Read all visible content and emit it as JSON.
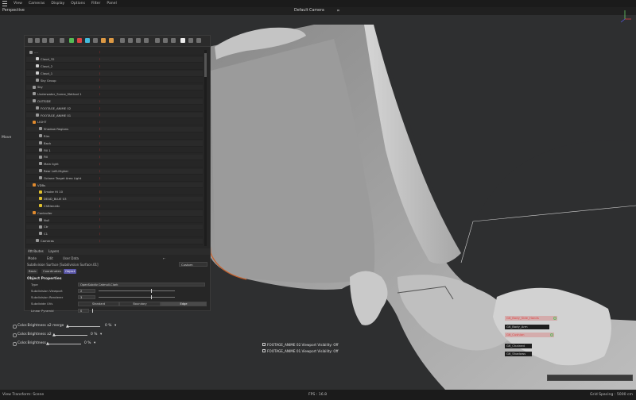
{
  "menubar": {
    "items": [
      "View",
      "Cameras",
      "Display",
      "Options",
      "Filter",
      "Panel"
    ]
  },
  "viewport": {
    "label": "Perspective",
    "camera": "Default Camera"
  },
  "left_tool": {
    "label": "Move"
  },
  "object_manager": {
    "rows": [
      {
        "name": "....",
        "indent": 0,
        "tag": "none"
      },
      {
        "name": "Cloud_32",
        "indent": 2,
        "tag": "eye"
      },
      {
        "name": "Cloud_2",
        "indent": 2,
        "tag": "eye"
      },
      {
        "name": "Cloud_1",
        "indent": 2,
        "tag": "eye"
      },
      {
        "name": "Sky Group",
        "indent": 2,
        "tag": "none"
      },
      {
        "name": "Sky",
        "indent": 1,
        "tag": "none"
      },
      {
        "name": "Underwater_Scene_Method 1",
        "indent": 1,
        "tag": "none"
      },
      {
        "name": "OUTSIDE",
        "indent": 1,
        "tag": "none"
      },
      {
        "name": "FOOTAGE_ANIME 02",
        "indent": 2,
        "tag": "none"
      },
      {
        "name": "FOOTAGE_ANIME 01",
        "indent": 2,
        "tag": "none"
      },
      {
        "name": "LIGHT",
        "indent": 1,
        "tag": "orange"
      },
      {
        "name": "Shadow Regions",
        "indent": 3,
        "tag": "none"
      },
      {
        "name": "Rim",
        "indent": 3,
        "tag": "none"
      },
      {
        "name": "Back",
        "indent": 3,
        "tag": "none"
      },
      {
        "name": "Fill 1",
        "indent": 3,
        "tag": "none"
      },
      {
        "name": "Fill",
        "indent": 3,
        "tag": "none"
      },
      {
        "name": "Main light",
        "indent": 3,
        "tag": "none"
      },
      {
        "name": "Rear Left-Higher",
        "indent": 3,
        "tag": "none"
      },
      {
        "name": "Octane Target Area Light",
        "indent": 3,
        "tag": "none"
      },
      {
        "name": "VDBs",
        "indent": 1,
        "tag": "orange"
      },
      {
        "name": "Smoke Hi 10",
        "indent": 3,
        "tag": "yellow"
      },
      {
        "name": "DEAD_BLUE 03",
        "indent": 3,
        "tag": "yellow"
      },
      {
        "name": "ChBlend4c",
        "indent": 3,
        "tag": "yellow"
      },
      {
        "name": "Controller",
        "indent": 1,
        "tag": "orange"
      },
      {
        "name": "Null",
        "indent": 3,
        "tag": "none"
      },
      {
        "name": "Ctr",
        "indent": 3,
        "tag": "none"
      },
      {
        "name": "C1",
        "indent": 3,
        "tag": "none"
      },
      {
        "name": "Cameras",
        "indent": 2,
        "tag": "none"
      }
    ]
  },
  "attributes": {
    "tabs": [
      "Attributes",
      "Layers"
    ],
    "menu": [
      "Mode",
      "Edit",
      "User Data"
    ],
    "object_line": "Subdivision Surface [Subdivision Surface.01]",
    "custom": "Custom",
    "subtabs": [
      "Basic",
      "Coordinates",
      "Object"
    ],
    "active_subtab": "Object",
    "section_title": "Object Properties",
    "type_label": "Type",
    "type_value": "OpenSubdiv Catmull-Clark",
    "editor_label": "Subdivision Viewport",
    "editor_value": "2",
    "render_label": "Subdivision Renderer",
    "render_value": "3",
    "uv_label": "Subdivide UVs",
    "uv_options": [
      "Standard",
      "Boundary",
      "Edge"
    ],
    "uv_selected": "Edge",
    "limit_label": "Linear Pyramid",
    "limit_value": "0"
  },
  "color_controls": [
    {
      "label": "Color.Brightness a2 merge",
      "value": "0 %",
      "pos": 0
    },
    {
      "label": "Color.Brightness a2",
      "value": "0 %",
      "pos": 0
    },
    {
      "label": "Color.Brightness",
      "value": "0 %",
      "pos": 0
    }
  ],
  "viewport_hud": [
    "FOOTAGE_ANIME 02.Viewport Visibility: Off",
    "FOOTAGE_ANIME 01.Viewport Visibility: Off"
  ],
  "right_labels": [
    {
      "text": "G6_Body_Side_Hands",
      "style": "red"
    },
    {
      "text": "G6_Body_Arm",
      "style": "normal"
    },
    {
      "text": "G6_Cushion",
      "style": "red"
    },
    {
      "text": "G6_Chained",
      "style": "normal"
    },
    {
      "text": "G6_Shadows",
      "style": "normal"
    }
  ],
  "status": {
    "left": "View Transform: Scene",
    "fps": "FPS : 16.8",
    "grid": "Grid Spacing : 5000 cm"
  },
  "colors": {
    "accent": "#5a56a8",
    "red_tag": "#d33333",
    "orange_tag": "#e08a2e",
    "yellow_tag": "#e0c02e"
  }
}
